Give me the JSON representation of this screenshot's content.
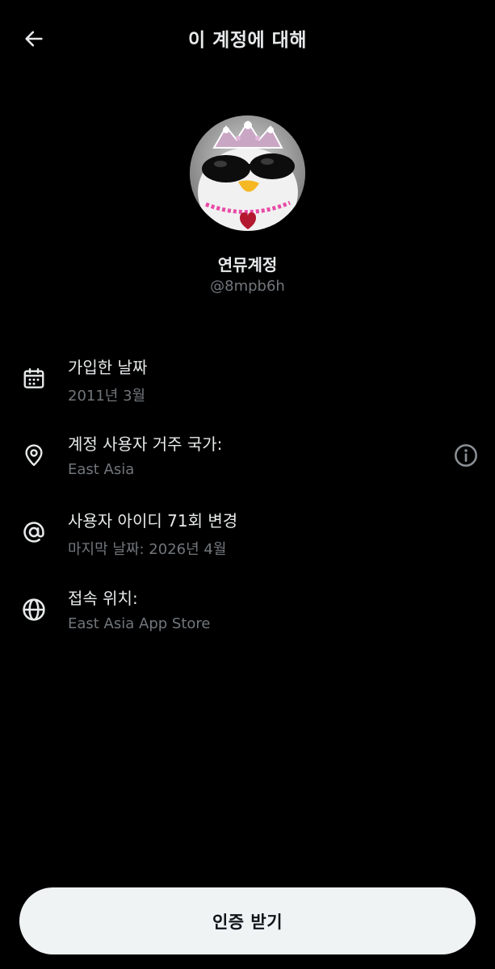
{
  "header": {
    "title": "이 계정에 대해",
    "back_icon": "arrow-left-icon"
  },
  "profile": {
    "display_name": "연뮤계정",
    "handle": "@8mpb6h",
    "avatar_icon": "avatar-image"
  },
  "info": {
    "joined": {
      "icon": "calendar-icon",
      "title": "가입한 날짜",
      "value": "2011년 3월"
    },
    "location": {
      "icon": "location-pin-icon",
      "title": "계정 사용자 거주 국가:",
      "value": "East Asia",
      "info_icon": "info-circle-icon"
    },
    "username_changes": {
      "icon": "at-sign-icon",
      "title": "사용자 아이디 71회 변경",
      "value": "마지막 날짜: 2026년 4월"
    },
    "connected_via": {
      "icon": "globe-icon",
      "title": "접속 위치:",
      "value": "East Asia App Store"
    }
  },
  "footer": {
    "verify_label": "인증 받기"
  },
  "colors": {
    "background": "#000000",
    "primary_text": "#e7e9ea",
    "secondary_text": "#71767b",
    "button_bg": "#eff3f4",
    "button_text": "#0f1419"
  }
}
